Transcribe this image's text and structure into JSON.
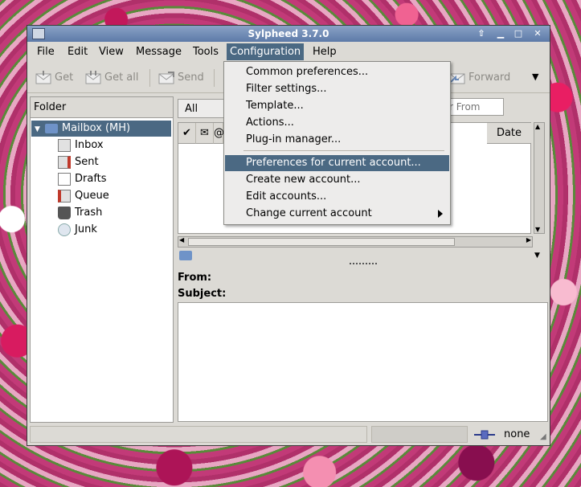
{
  "window": {
    "title": "Sylpheed 3.7.0"
  },
  "menubar": [
    "File",
    "Edit",
    "View",
    "Message",
    "Tools",
    "Configuration",
    "Help"
  ],
  "toolbar": {
    "get": "Get",
    "get_all": "Get all",
    "send": "Send",
    "forward": "Forward"
  },
  "folders": {
    "header": "Folder",
    "root": "Mailbox (MH)",
    "items": [
      "Inbox",
      "Sent",
      "Drafts",
      "Queue",
      "Trash",
      "Junk"
    ]
  },
  "filter": {
    "view": "All",
    "search_placeholder": "r From"
  },
  "summary": {
    "date_column": "Date"
  },
  "message": {
    "from_label": "From:",
    "subject_label": "Subject:"
  },
  "status": {
    "connection": "none"
  },
  "config_menu": {
    "items": [
      "Common preferences...",
      "Filter settings...",
      "Template...",
      "Actions...",
      "Plug-in manager...",
      "Preferences for current account...",
      "Create new account...",
      "Edit accounts...",
      "Change current account"
    ],
    "highlighted": "Preferences for current account..."
  },
  "colors": {
    "accent": "#4b6983",
    "window_bg": "#dcdad5"
  }
}
